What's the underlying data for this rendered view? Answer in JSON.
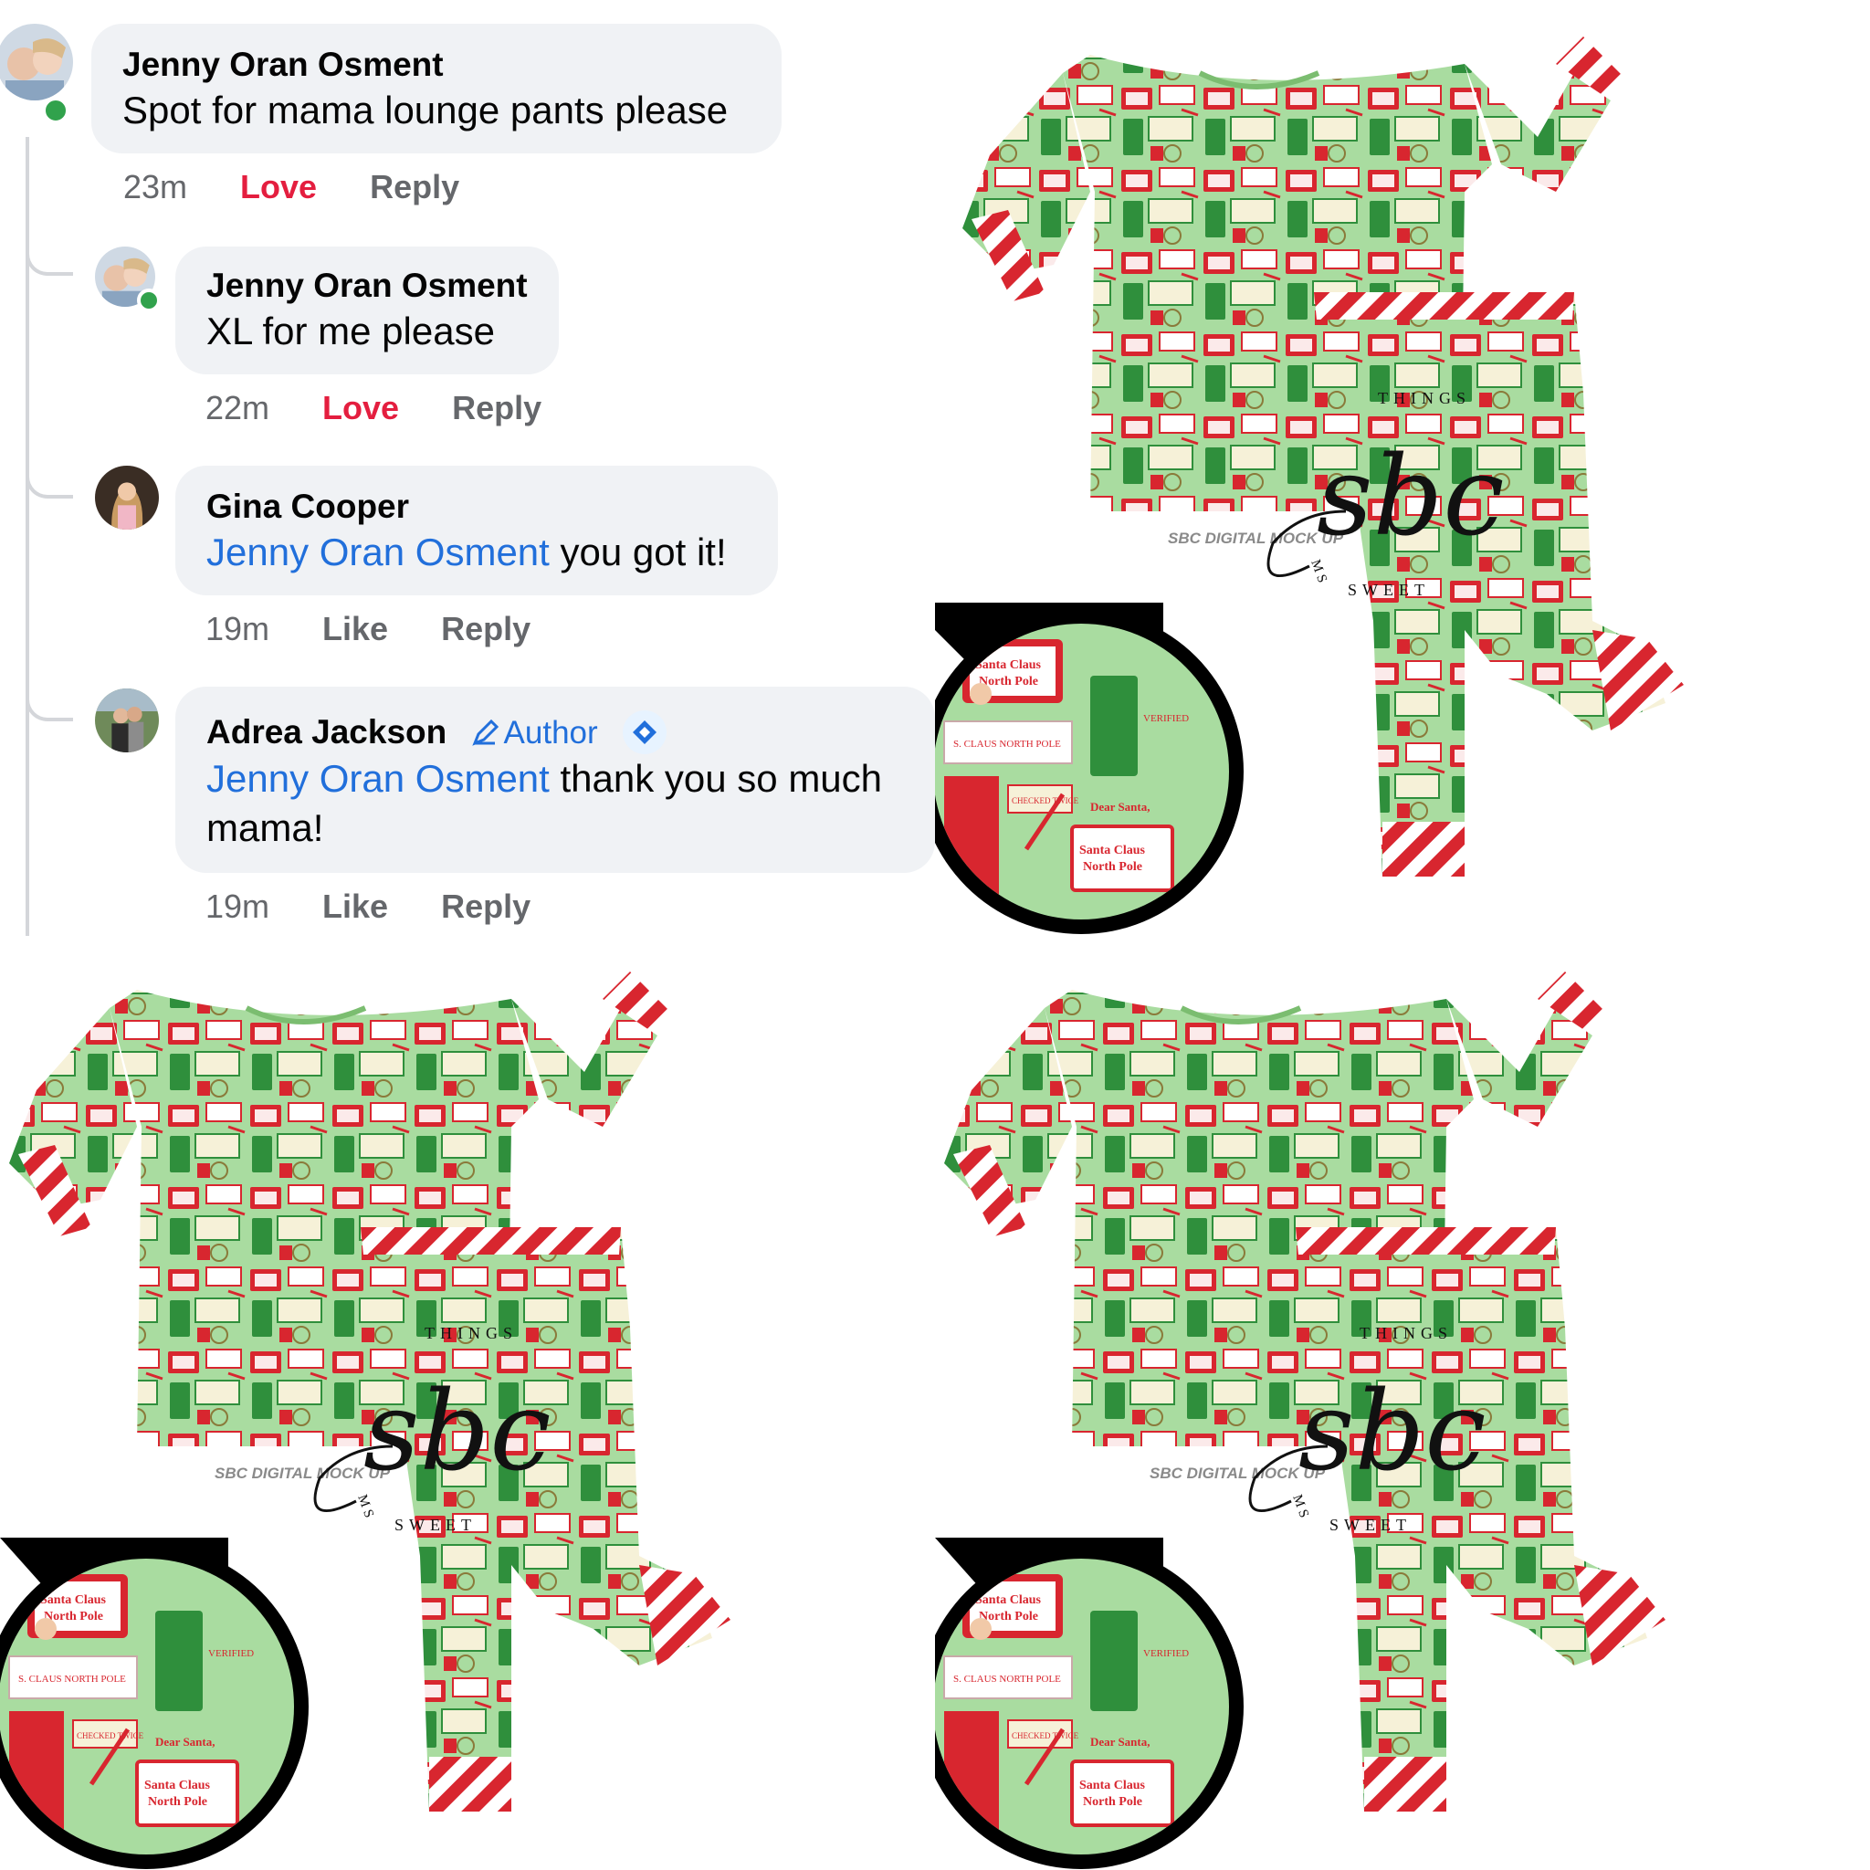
{
  "comments": [
    {
      "author": "Jenny Oran Osment",
      "text": "Spot for mama lounge pants please",
      "time": "23m",
      "action1": "Love",
      "action2": "Reply",
      "online": true
    },
    {
      "author": "Jenny Oran Osment",
      "text": "XL for me please",
      "time": "22m",
      "action1": "Love",
      "action2": "Reply",
      "online": true
    },
    {
      "author": "Gina Cooper",
      "mention": "Jenny Oran Osment",
      "text": " you got it!",
      "time": "19m",
      "action1": "Like",
      "action2": "Reply"
    },
    {
      "author": "Adrea Jackson",
      "badge": "Author",
      "mention": "Jenny Oran Osment",
      "text": " thank you so much mama!",
      "time": "19m",
      "action1": "Like",
      "action2": "Reply"
    }
  ],
  "mockup": {
    "watermark": "SBC DIGITAL MOCK UP",
    "logo_arc_top": "THINGS",
    "logo_arc_bottom": "SWEET",
    "logo_letters": "MS",
    "logo_script": "sbc",
    "print_label_1": "Santa Claus",
    "print_label_2": "North Pole",
    "print_label_3": "S. CLAUS NORTH POLE",
    "print_label_4": "VERIFIED",
    "print_label_5": "Dear Santa,",
    "print_label_6": "CHECKED TWICE"
  },
  "colors": {
    "fabric_green": "#a9dca0",
    "print_red": "#d8262f",
    "print_dark_green": "#2f8f3c",
    "link_blue": "#216fdb",
    "love_red": "#e41e3f"
  }
}
